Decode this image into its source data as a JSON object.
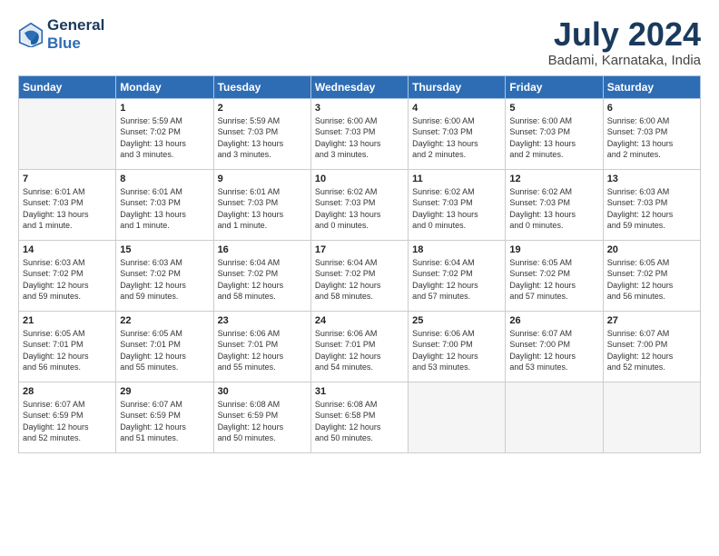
{
  "header": {
    "logo_line1": "General",
    "logo_line2": "Blue",
    "title": "July 2024",
    "location": "Badami, Karnataka, India"
  },
  "days_of_week": [
    "Sunday",
    "Monday",
    "Tuesday",
    "Wednesday",
    "Thursday",
    "Friday",
    "Saturday"
  ],
  "weeks": [
    [
      {
        "day": "",
        "info": ""
      },
      {
        "day": "1",
        "info": "Sunrise: 5:59 AM\nSunset: 7:02 PM\nDaylight: 13 hours\nand 3 minutes."
      },
      {
        "day": "2",
        "info": "Sunrise: 5:59 AM\nSunset: 7:03 PM\nDaylight: 13 hours\nand 3 minutes."
      },
      {
        "day": "3",
        "info": "Sunrise: 6:00 AM\nSunset: 7:03 PM\nDaylight: 13 hours\nand 3 minutes."
      },
      {
        "day": "4",
        "info": "Sunrise: 6:00 AM\nSunset: 7:03 PM\nDaylight: 13 hours\nand 2 minutes."
      },
      {
        "day": "5",
        "info": "Sunrise: 6:00 AM\nSunset: 7:03 PM\nDaylight: 13 hours\nand 2 minutes."
      },
      {
        "day": "6",
        "info": "Sunrise: 6:00 AM\nSunset: 7:03 PM\nDaylight: 13 hours\nand 2 minutes."
      }
    ],
    [
      {
        "day": "7",
        "info": "Sunrise: 6:01 AM\nSunset: 7:03 PM\nDaylight: 13 hours\nand 1 minute."
      },
      {
        "day": "8",
        "info": "Sunrise: 6:01 AM\nSunset: 7:03 PM\nDaylight: 13 hours\nand 1 minute."
      },
      {
        "day": "9",
        "info": "Sunrise: 6:01 AM\nSunset: 7:03 PM\nDaylight: 13 hours\nand 1 minute."
      },
      {
        "day": "10",
        "info": "Sunrise: 6:02 AM\nSunset: 7:03 PM\nDaylight: 13 hours\nand 0 minutes."
      },
      {
        "day": "11",
        "info": "Sunrise: 6:02 AM\nSunset: 7:03 PM\nDaylight: 13 hours\nand 0 minutes."
      },
      {
        "day": "12",
        "info": "Sunrise: 6:02 AM\nSunset: 7:03 PM\nDaylight: 13 hours\nand 0 minutes."
      },
      {
        "day": "13",
        "info": "Sunrise: 6:03 AM\nSunset: 7:03 PM\nDaylight: 12 hours\nand 59 minutes."
      }
    ],
    [
      {
        "day": "14",
        "info": "Sunrise: 6:03 AM\nSunset: 7:02 PM\nDaylight: 12 hours\nand 59 minutes."
      },
      {
        "day": "15",
        "info": "Sunrise: 6:03 AM\nSunset: 7:02 PM\nDaylight: 12 hours\nand 59 minutes."
      },
      {
        "day": "16",
        "info": "Sunrise: 6:04 AM\nSunset: 7:02 PM\nDaylight: 12 hours\nand 58 minutes."
      },
      {
        "day": "17",
        "info": "Sunrise: 6:04 AM\nSunset: 7:02 PM\nDaylight: 12 hours\nand 58 minutes."
      },
      {
        "day": "18",
        "info": "Sunrise: 6:04 AM\nSunset: 7:02 PM\nDaylight: 12 hours\nand 57 minutes."
      },
      {
        "day": "19",
        "info": "Sunrise: 6:05 AM\nSunset: 7:02 PM\nDaylight: 12 hours\nand 57 minutes."
      },
      {
        "day": "20",
        "info": "Sunrise: 6:05 AM\nSunset: 7:02 PM\nDaylight: 12 hours\nand 56 minutes."
      }
    ],
    [
      {
        "day": "21",
        "info": "Sunrise: 6:05 AM\nSunset: 7:01 PM\nDaylight: 12 hours\nand 56 minutes."
      },
      {
        "day": "22",
        "info": "Sunrise: 6:05 AM\nSunset: 7:01 PM\nDaylight: 12 hours\nand 55 minutes."
      },
      {
        "day": "23",
        "info": "Sunrise: 6:06 AM\nSunset: 7:01 PM\nDaylight: 12 hours\nand 55 minutes."
      },
      {
        "day": "24",
        "info": "Sunrise: 6:06 AM\nSunset: 7:01 PM\nDaylight: 12 hours\nand 54 minutes."
      },
      {
        "day": "25",
        "info": "Sunrise: 6:06 AM\nSunset: 7:00 PM\nDaylight: 12 hours\nand 53 minutes."
      },
      {
        "day": "26",
        "info": "Sunrise: 6:07 AM\nSunset: 7:00 PM\nDaylight: 12 hours\nand 53 minutes."
      },
      {
        "day": "27",
        "info": "Sunrise: 6:07 AM\nSunset: 7:00 PM\nDaylight: 12 hours\nand 52 minutes."
      }
    ],
    [
      {
        "day": "28",
        "info": "Sunrise: 6:07 AM\nSunset: 6:59 PM\nDaylight: 12 hours\nand 52 minutes."
      },
      {
        "day": "29",
        "info": "Sunrise: 6:07 AM\nSunset: 6:59 PM\nDaylight: 12 hours\nand 51 minutes."
      },
      {
        "day": "30",
        "info": "Sunrise: 6:08 AM\nSunset: 6:59 PM\nDaylight: 12 hours\nand 50 minutes."
      },
      {
        "day": "31",
        "info": "Sunrise: 6:08 AM\nSunset: 6:58 PM\nDaylight: 12 hours\nand 50 minutes."
      },
      {
        "day": "",
        "info": ""
      },
      {
        "day": "",
        "info": ""
      },
      {
        "day": "",
        "info": ""
      }
    ]
  ]
}
